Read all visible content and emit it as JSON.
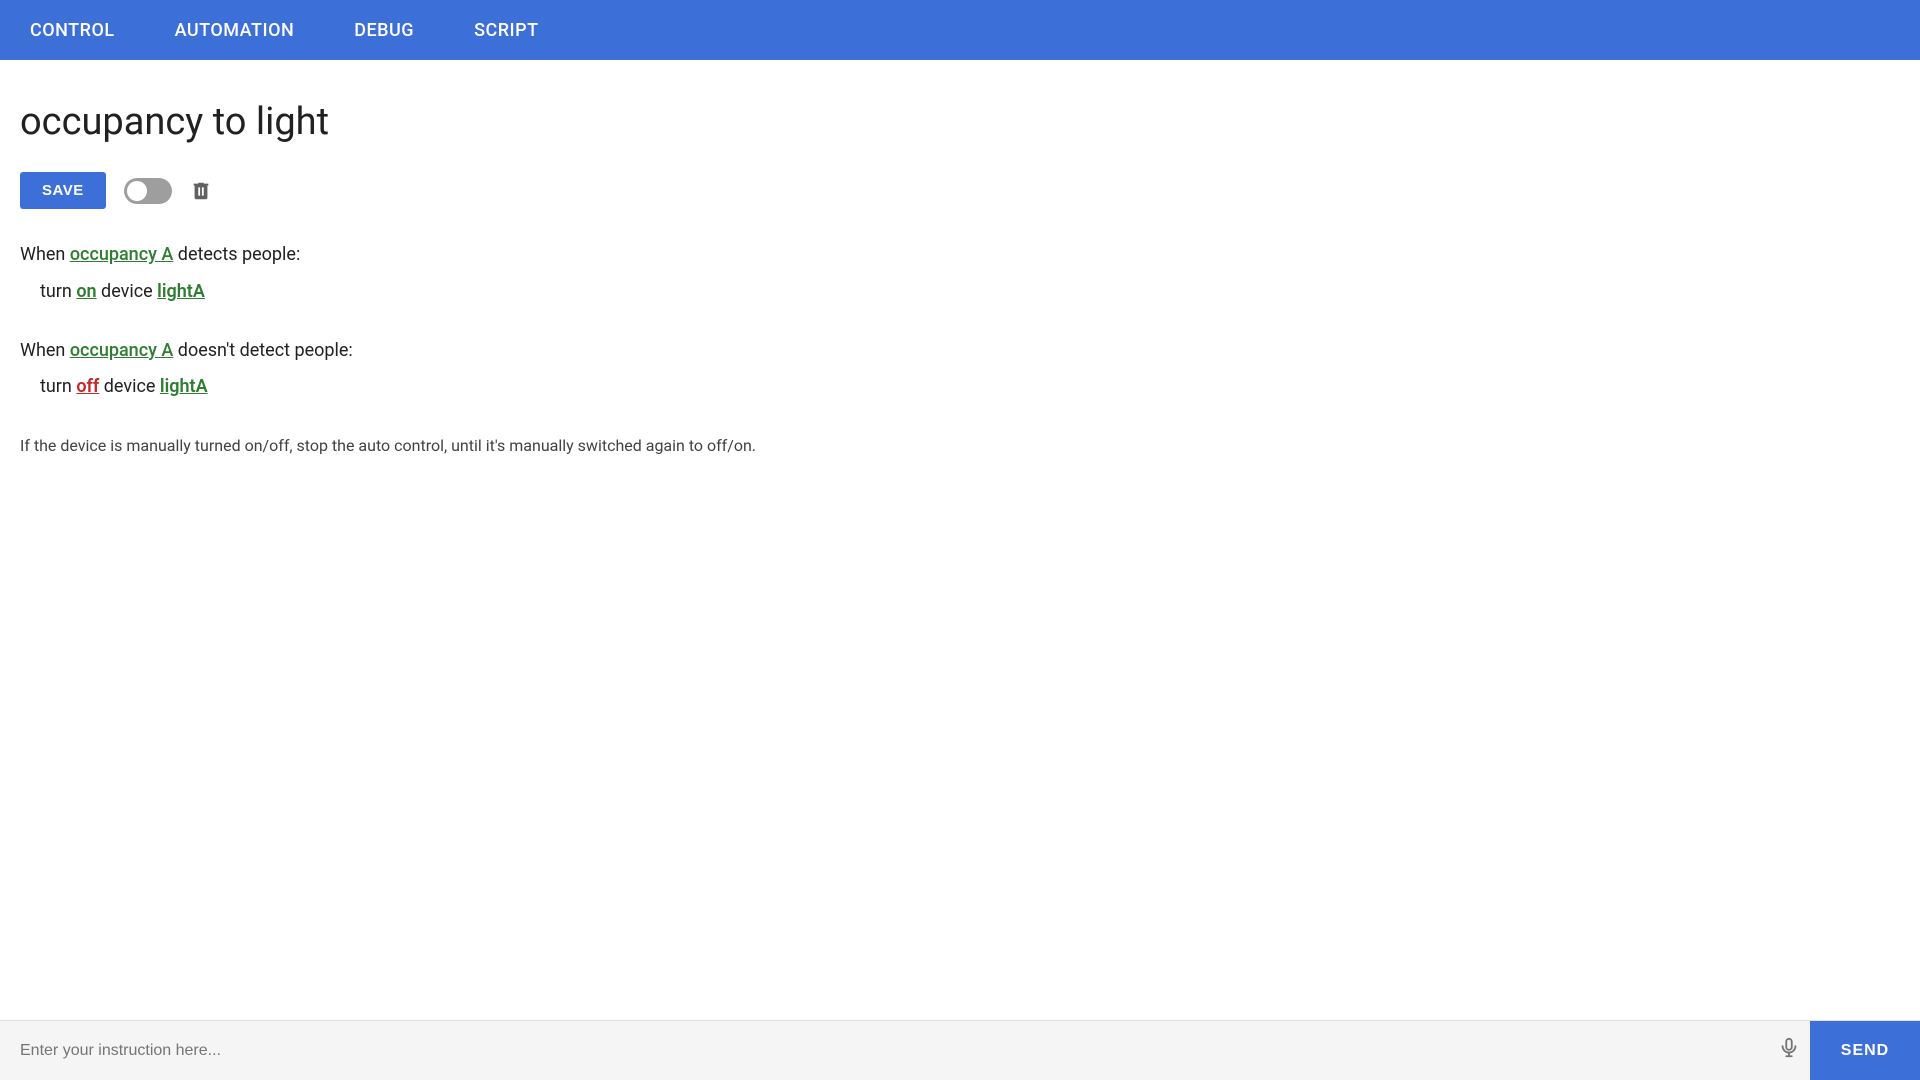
{
  "navbar": {
    "items": [
      {
        "id": "control",
        "label": "CONTROL"
      },
      {
        "id": "automation",
        "label": "AUTOMATION"
      },
      {
        "id": "debug",
        "label": "DEBUG"
      },
      {
        "id": "script",
        "label": "SCRIPT"
      }
    ]
  },
  "page": {
    "title": "occupancy to light",
    "toolbar": {
      "save_label": "SAVE",
      "delete_label": "Delete"
    },
    "rule_blocks": [
      {
        "id": "block1",
        "prefix": "When",
        "trigger_link": "occupancy A",
        "suffix": "detects people:"
      },
      {
        "id": "block1_action",
        "prefix": "turn",
        "state_link": "on",
        "middle": "device",
        "device_link": "lightA"
      },
      {
        "id": "block2",
        "prefix": "When",
        "trigger_link": "occupancy A",
        "suffix": "doesn't detect people:"
      },
      {
        "id": "block2_action",
        "prefix": "turn",
        "state_link": "off",
        "middle": "device",
        "device_link": "lightA"
      }
    ],
    "note": "If the device is manually turned on/off, stop the auto control, until it's manually switched again to off/on."
  },
  "bottom_bar": {
    "input_placeholder": "Enter your instruction here...",
    "send_label": "SEND"
  }
}
